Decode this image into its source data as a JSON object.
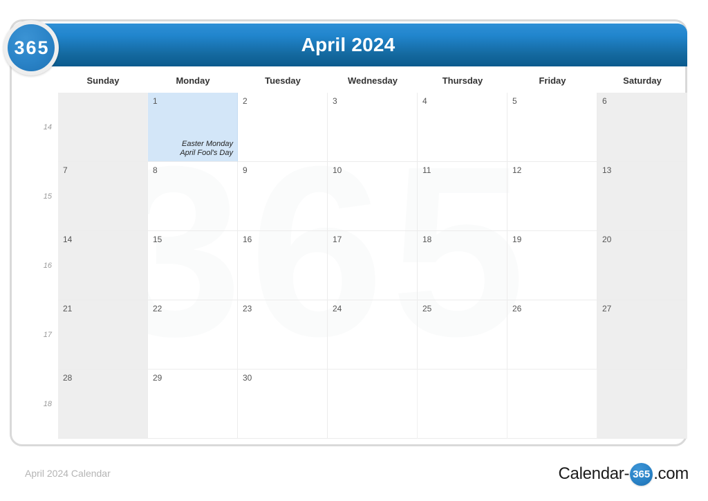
{
  "header": {
    "title": "April 2024",
    "badge_label": "365",
    "accent_color": "#2185cd",
    "gradient_top": "#2f90d6",
    "gradient_bottom": "#0b5a8d"
  },
  "weekdays": [
    "Sunday",
    "Monday",
    "Tuesday",
    "Wednesday",
    "Thursday",
    "Friday",
    "Saturday"
  ],
  "watermark_text": "365",
  "weeks": [
    {
      "week_number": "14",
      "days": [
        {
          "number": "",
          "empty": true,
          "weekend": true,
          "highlight": false,
          "events": []
        },
        {
          "number": "1",
          "empty": false,
          "weekend": false,
          "highlight": true,
          "events": [
            "Easter Monday",
            "April Fool's Day"
          ]
        },
        {
          "number": "2",
          "empty": false,
          "weekend": false,
          "highlight": false,
          "events": []
        },
        {
          "number": "3",
          "empty": false,
          "weekend": false,
          "highlight": false,
          "events": []
        },
        {
          "number": "4",
          "empty": false,
          "weekend": false,
          "highlight": false,
          "events": []
        },
        {
          "number": "5",
          "empty": false,
          "weekend": false,
          "highlight": false,
          "events": []
        },
        {
          "number": "6",
          "empty": false,
          "weekend": true,
          "highlight": false,
          "events": []
        }
      ]
    },
    {
      "week_number": "15",
      "days": [
        {
          "number": "7",
          "empty": false,
          "weekend": true,
          "highlight": false,
          "events": []
        },
        {
          "number": "8",
          "empty": false,
          "weekend": false,
          "highlight": false,
          "events": []
        },
        {
          "number": "9",
          "empty": false,
          "weekend": false,
          "highlight": false,
          "events": []
        },
        {
          "number": "10",
          "empty": false,
          "weekend": false,
          "highlight": false,
          "events": []
        },
        {
          "number": "11",
          "empty": false,
          "weekend": false,
          "highlight": false,
          "events": []
        },
        {
          "number": "12",
          "empty": false,
          "weekend": false,
          "highlight": false,
          "events": []
        },
        {
          "number": "13",
          "empty": false,
          "weekend": true,
          "highlight": false,
          "events": []
        }
      ]
    },
    {
      "week_number": "16",
      "days": [
        {
          "number": "14",
          "empty": false,
          "weekend": true,
          "highlight": false,
          "events": []
        },
        {
          "number": "15",
          "empty": false,
          "weekend": false,
          "highlight": false,
          "events": []
        },
        {
          "number": "16",
          "empty": false,
          "weekend": false,
          "highlight": false,
          "events": []
        },
        {
          "number": "17",
          "empty": false,
          "weekend": false,
          "highlight": false,
          "events": []
        },
        {
          "number": "18",
          "empty": false,
          "weekend": false,
          "highlight": false,
          "events": []
        },
        {
          "number": "19",
          "empty": false,
          "weekend": false,
          "highlight": false,
          "events": []
        },
        {
          "number": "20",
          "empty": false,
          "weekend": true,
          "highlight": false,
          "events": []
        }
      ]
    },
    {
      "week_number": "17",
      "days": [
        {
          "number": "21",
          "empty": false,
          "weekend": true,
          "highlight": false,
          "events": []
        },
        {
          "number": "22",
          "empty": false,
          "weekend": false,
          "highlight": false,
          "events": []
        },
        {
          "number": "23",
          "empty": false,
          "weekend": false,
          "highlight": false,
          "events": []
        },
        {
          "number": "24",
          "empty": false,
          "weekend": false,
          "highlight": false,
          "events": []
        },
        {
          "number": "25",
          "empty": false,
          "weekend": false,
          "highlight": false,
          "events": []
        },
        {
          "number": "26",
          "empty": false,
          "weekend": false,
          "highlight": false,
          "events": []
        },
        {
          "number": "27",
          "empty": false,
          "weekend": true,
          "highlight": false,
          "events": []
        }
      ]
    },
    {
      "week_number": "18",
      "days": [
        {
          "number": "28",
          "empty": false,
          "weekend": true,
          "highlight": false,
          "events": []
        },
        {
          "number": "29",
          "empty": false,
          "weekend": false,
          "highlight": false,
          "events": []
        },
        {
          "number": "30",
          "empty": false,
          "weekend": false,
          "highlight": false,
          "events": []
        },
        {
          "number": "",
          "empty": true,
          "weekend": false,
          "highlight": false,
          "events": []
        },
        {
          "number": "",
          "empty": true,
          "weekend": false,
          "highlight": false,
          "events": []
        },
        {
          "number": "",
          "empty": true,
          "weekend": false,
          "highlight": false,
          "events": []
        },
        {
          "number": "",
          "empty": true,
          "weekend": true,
          "highlight": false,
          "events": []
        }
      ]
    }
  ],
  "footer": {
    "caption": "April 2024 Calendar",
    "logo_prefix": "Calendar-",
    "logo_badge": "365",
    "logo_suffix": ".com"
  }
}
